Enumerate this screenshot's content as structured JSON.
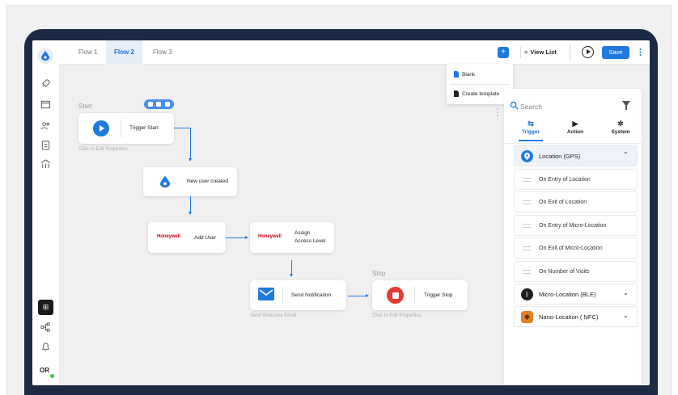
{
  "tabs": [
    "Flow 1",
    "Flow 2",
    "Flow 3"
  ],
  "topbar": {
    "plus": "+",
    "view_list": "View List",
    "save": "Save",
    "kebab": "⋮"
  },
  "dropdown": {
    "blank": "Blank",
    "create_template": "Create template"
  },
  "canvas": {
    "start_label": "Start",
    "trigger_start": "Trigger Start",
    "click_edit": "Click to Edit Properties",
    "new_user": "New user created",
    "honeywell": "Honeywell",
    "add_user": "Add User",
    "assign_access": "Assign Access Level",
    "assign_line1": "Assign",
    "assign_line2": "Access Level",
    "send_notification": "Send Notification",
    "send_welcome": "Send Welcome Email",
    "stop_label": "Stop",
    "trigger_stop": "Trigger Stop",
    "click_edit_stop": "Click to Edit Properties"
  },
  "panel": {
    "search_placeholder": "Search",
    "tabs": [
      "Trigger",
      "Action",
      "System"
    ],
    "location_gps": "Location (GPS)",
    "items": [
      "On Entry of Location",
      "On Exit of Location",
      "On Entry of Micro-Location",
      "On Exit of Micro-Location",
      "On Number of Visits"
    ],
    "micro_location": "Micro-Location (BLE)",
    "nano_location": "Nano-Location ( NFC)"
  },
  "sidebar": {
    "user_initials": "OR"
  },
  "colors": {
    "accent": "#1f7ae0",
    "device": "#1d2a44",
    "honeywell": "#d6001c",
    "stop": "#e53935"
  }
}
